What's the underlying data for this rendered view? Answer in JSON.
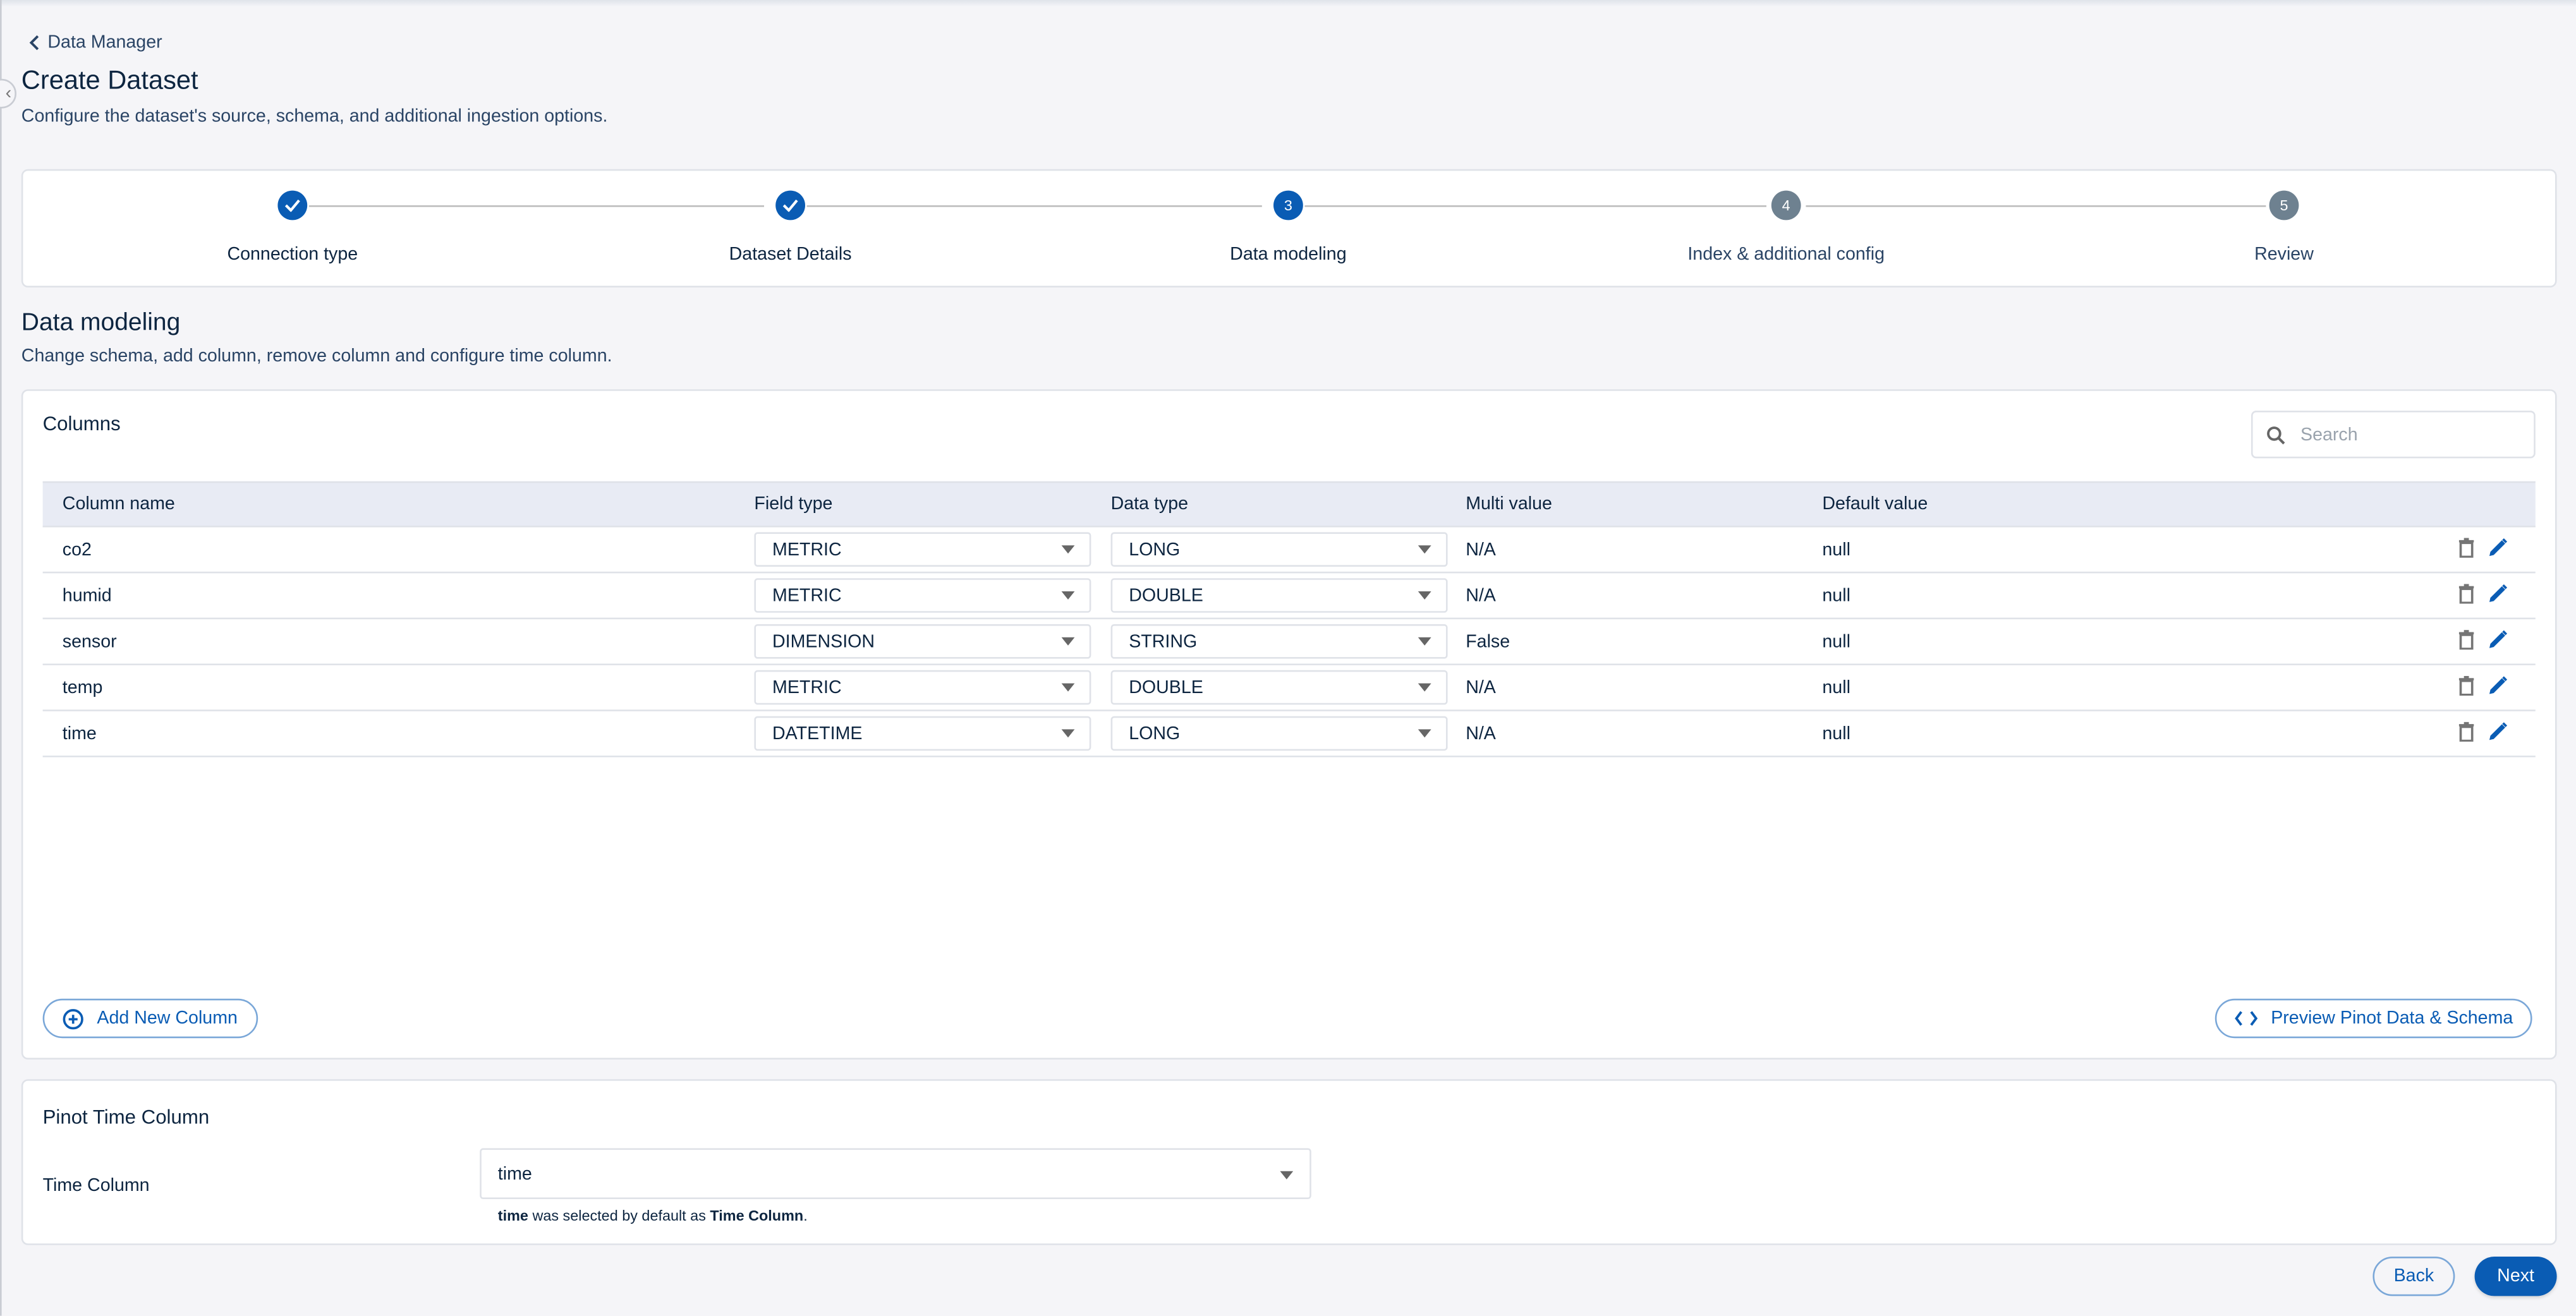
{
  "breadcrumb": {
    "label": "Data Manager"
  },
  "page": {
    "title": "Create Dataset",
    "subtitle": "Configure the dataset's source, schema, and additional ingestion options."
  },
  "stepper": {
    "steps": [
      {
        "number": "1",
        "label": "Connection type",
        "status": "completed"
      },
      {
        "number": "2",
        "label": "Dataset Details",
        "status": "completed"
      },
      {
        "number": "3",
        "label": "Data modeling",
        "status": "active"
      },
      {
        "number": "4",
        "label": "Index & additional config",
        "status": "upcoming"
      },
      {
        "number": "5",
        "label": "Review",
        "status": "upcoming"
      }
    ]
  },
  "section": {
    "title": "Data modeling",
    "subtitle": "Change schema, add column, remove column and configure time column."
  },
  "columns": {
    "title": "Columns",
    "search_placeholder": "Search",
    "headers": [
      "Column name",
      "Field type",
      "Data type",
      "Multi value",
      "Default value"
    ],
    "rows": [
      {
        "name": "co2",
        "field_type": "METRIC",
        "data_type": "LONG",
        "multi_value": "N/A",
        "default_value": "null"
      },
      {
        "name": "humid",
        "field_type": "METRIC",
        "data_type": "DOUBLE",
        "multi_value": "N/A",
        "default_value": "null"
      },
      {
        "name": "sensor",
        "field_type": "DIMENSION",
        "data_type": "STRING",
        "multi_value": "False",
        "default_value": "null"
      },
      {
        "name": "temp",
        "field_type": "METRIC",
        "data_type": "DOUBLE",
        "multi_value": "N/A",
        "default_value": "null"
      },
      {
        "name": "time",
        "field_type": "DATETIME",
        "data_type": "LONG",
        "multi_value": "N/A",
        "default_value": "null"
      }
    ],
    "add_button": "Add New Column",
    "preview_button": "Preview Pinot Data & Schema"
  },
  "time_column": {
    "title": "Pinot Time Column",
    "label": "Time Column",
    "value": "time",
    "hint_column": "time",
    "hint_middle": " was selected by default as ",
    "hint_target": "Time Column",
    "hint_end": "."
  },
  "footer": {
    "back": "Back",
    "next": "Next"
  },
  "colors": {
    "primary": "#0a5cb4",
    "upcoming": "#6e8190",
    "header_bg": "#e8ebf4",
    "page_bg": "#f5f5f8"
  }
}
